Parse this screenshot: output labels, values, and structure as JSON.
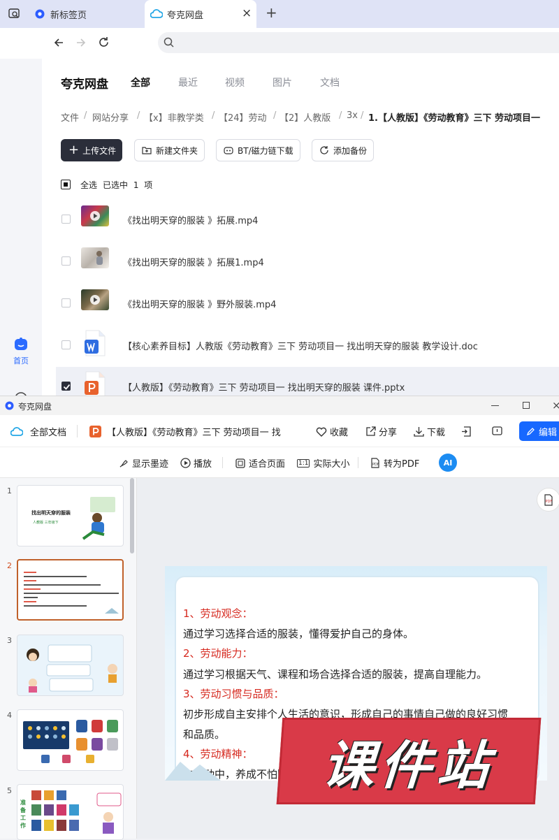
{
  "browser": {
    "tabs": [
      {
        "label": "新标签页",
        "icon": "browser-logo-icon"
      },
      {
        "label": "夸克网盘",
        "icon": "cloud-icon",
        "close": "×"
      }
    ],
    "new_tab": "+",
    "address_placeholder": ""
  },
  "page": {
    "logo": "夸克网盘",
    "nav_tabs": [
      "全部",
      "最近",
      "视频",
      "图片",
      "文档"
    ],
    "active_tab": "全部",
    "rail": {
      "home_label": "首页"
    },
    "breadcrumb": [
      "文件",
      "网站分享",
      "【x】非教学类",
      "【24】劳动",
      "【2】人教版",
      "3x",
      "1.【人教版】《劳动教育》三下 劳动项目一"
    ],
    "crumb_sep": "/",
    "buttons": {
      "upload": "上传文件",
      "new_folder": "新建文件夹",
      "bt": "BT/磁力链下载",
      "backup": "添加备份"
    },
    "select_all": "全选",
    "selected_count": "已选中 1 项",
    "files": [
      {
        "name": "《找出明天穿的服装 》拓展.mp4",
        "type": "video",
        "checked": false
      },
      {
        "name": "《找出明天穿的服装 》拓展1.mp4",
        "type": "video",
        "checked": false
      },
      {
        "name": "《找出明天穿的服装 》野外服装.mp4",
        "type": "video",
        "checked": false
      },
      {
        "name": "【核心素养目标】人教版《劳动教育》三下 劳动项目一 找出明天穿的服装 教学设计.doc",
        "type": "word",
        "checked": false
      },
      {
        "name": "【人教版】《劳动教育》三下 劳动项目一 找出明天穿的服装 课件.pptx",
        "type": "ppt",
        "checked": true
      }
    ]
  },
  "viewer": {
    "window_title": "夸克网盘",
    "all_docs": "全部文档",
    "doc_title": "【人教版】《劳动教育》三下 劳动项目一 找",
    "favorite": "收藏",
    "share": "分享",
    "download": "下载",
    "edit": "编辑",
    "toolbar": {
      "ink": "显示墨迹",
      "play": "播放",
      "fit": "适合页面",
      "actual": "实际大小",
      "to_pdf": "转为PDF",
      "ai": "AI"
    },
    "thumb_numbers": [
      "1",
      "2",
      "3",
      "4",
      "5"
    ],
    "thumb1_title": "找出明天穿的服装",
    "thumb1_sub": "人教版 三年级下",
    "thumb5_label": "准备工作",
    "slide_lines": [
      {
        "text": "1、劳动观念：",
        "color": "red"
      },
      {
        "text": "通过学习选择合适的服装，懂得爱护自己的身体。",
        "color": "black"
      },
      {
        "text": "2、劳动能力：",
        "color": "red"
      },
      {
        "text": "通过学习根据天气、课程和场合选择合适的服装，提高自理能力。",
        "color": "black"
      },
      {
        "text": "3、劳动习惯与品质：",
        "color": "red"
      },
      {
        "text": "初步形成自主安排个人生活的意识，形成自己的事情自己做的良好习惯",
        "color": "black"
      },
      {
        "text": "和品质。",
        "color": "black"
      },
      {
        "text": "4、劳动精神：",
        "color": "red"
      },
      {
        "text": "在劳动中，养成不怕困难、热爱劳动的劳动精神。",
        "color": "black"
      }
    ],
    "watermark": "课件站"
  },
  "colors": {
    "accent": "#1768ff",
    "dark_button": "#2b2e3a",
    "red_text": "#d6291f",
    "watermark": "#d93a48"
  }
}
